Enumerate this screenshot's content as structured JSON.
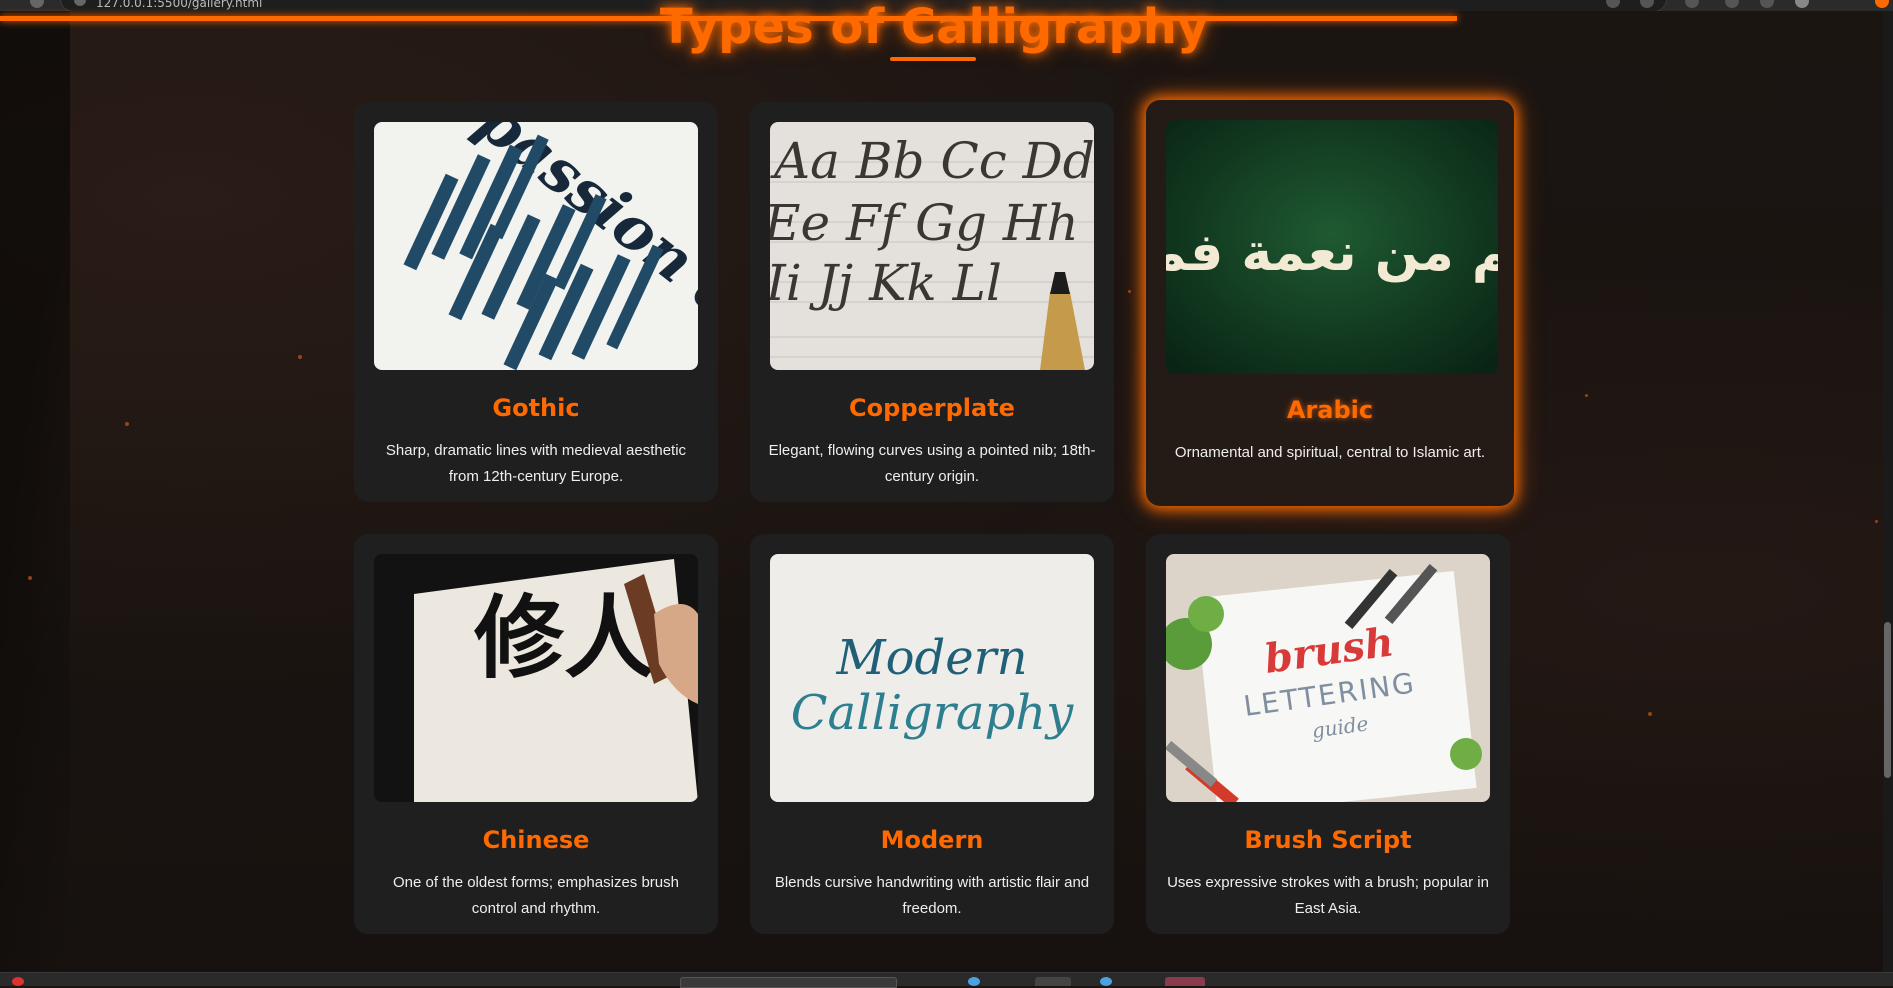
{
  "browser": {
    "url": "127.0.0.1:5500/gallery.html",
    "progress_color": "#ff6a00"
  },
  "page": {
    "title": "Types of Calligraphy",
    "accent_color": "#ff6a00"
  },
  "cards": [
    {
      "name": "Gothic",
      "description": "Sharp, dramatic lines with medieval aesthetic from 12th-century Europe.",
      "image_text": "passion doesn't sleep",
      "active": false
    },
    {
      "name": "Copperplate",
      "description": "Elegant, flowing curves using a pointed nib; 18th-century origin.",
      "image_text": "Aa Bb Cc Dd Ee Ff Gg Hh Ii Jj Kk Ll",
      "active": false
    },
    {
      "name": "Arabic",
      "description": "Ornamental and spiritual, central to Islamic art.",
      "image_text": "وما بكم من نعمة فمن الله",
      "active": true
    },
    {
      "name": "Chinese",
      "description": "One of the oldest forms; emphasizes brush control and rhythm.",
      "image_text": "修人",
      "active": false
    },
    {
      "name": "Modern",
      "description": "Blends cursive handwriting with artistic flair and freedom.",
      "image_text": "Modern Calligraphy",
      "active": false
    },
    {
      "name": "Brush Script",
      "description": "Uses expressive strokes with a brush; popular in East Asia.",
      "image_text": "brush LETTERING guide",
      "active": false
    }
  ]
}
